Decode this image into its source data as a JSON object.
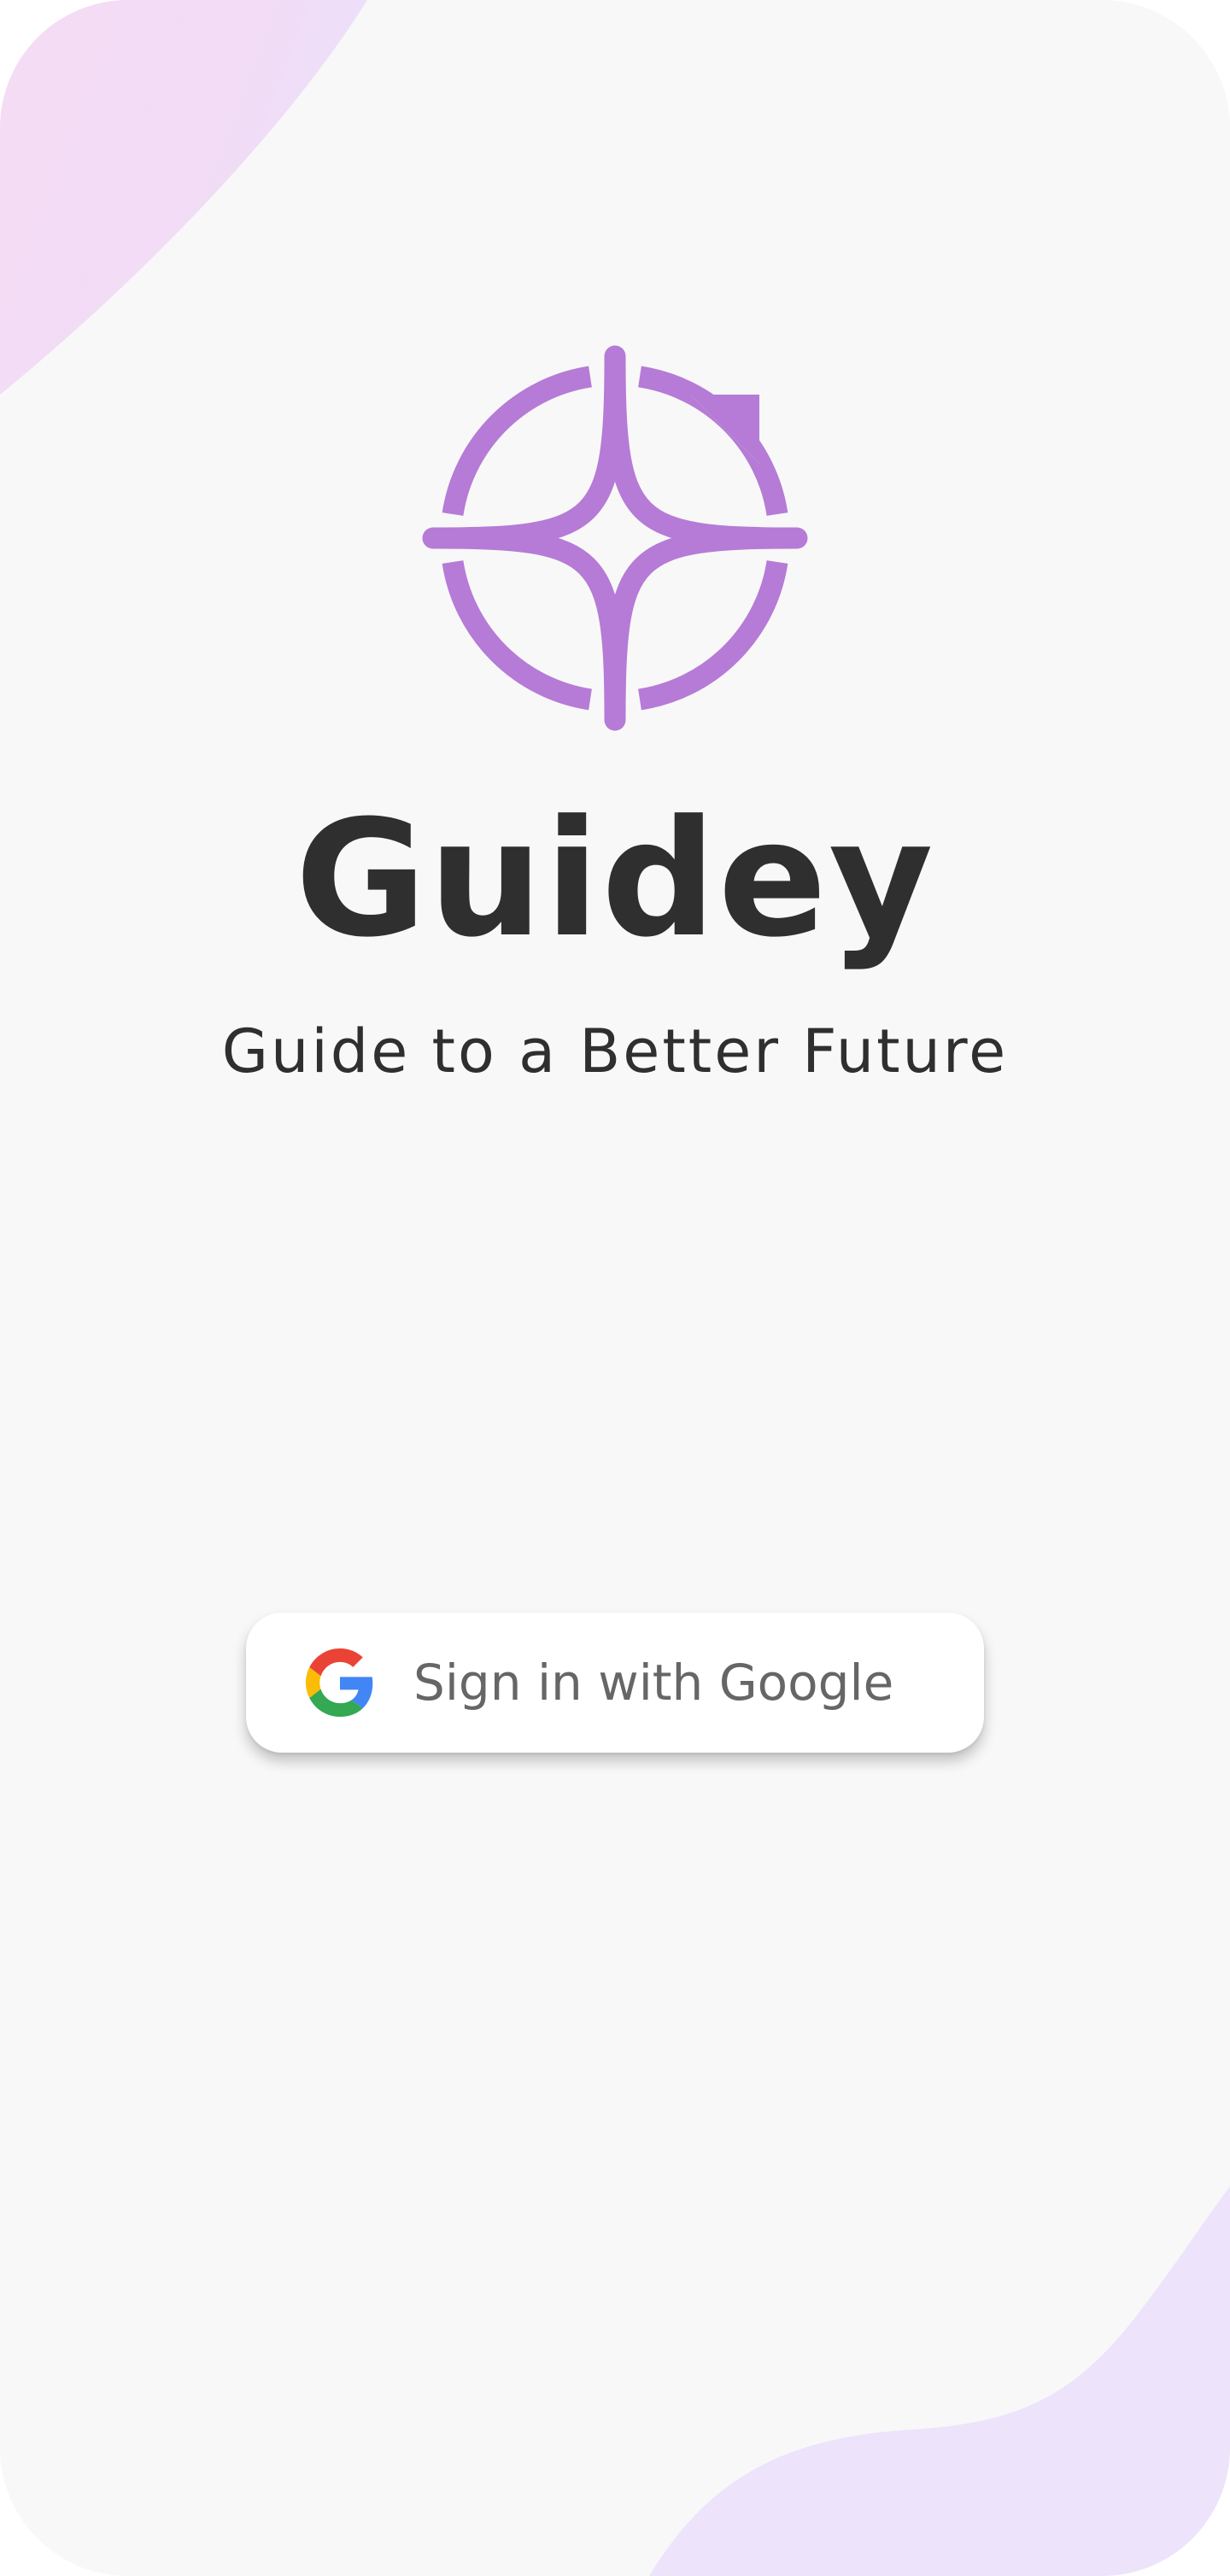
{
  "app": {
    "name": "Guidey",
    "tagline": "Guide to a Better Future",
    "logo_icon": "compass-star-icon"
  },
  "signin": {
    "button_label": "Sign in with Google",
    "icon": "google-icon"
  },
  "colors": {
    "background": "#f8f8f8",
    "brand_purple": "#b57bd6",
    "text_dark": "#2f2f2f",
    "button_text": "#666666",
    "blob_pink": "#f3dcf5",
    "blob_lavender": "#ede3fb",
    "google_blue": "#4285F4",
    "google_red": "#EA4335",
    "google_yellow": "#FBBC05",
    "google_green": "#34A853"
  }
}
